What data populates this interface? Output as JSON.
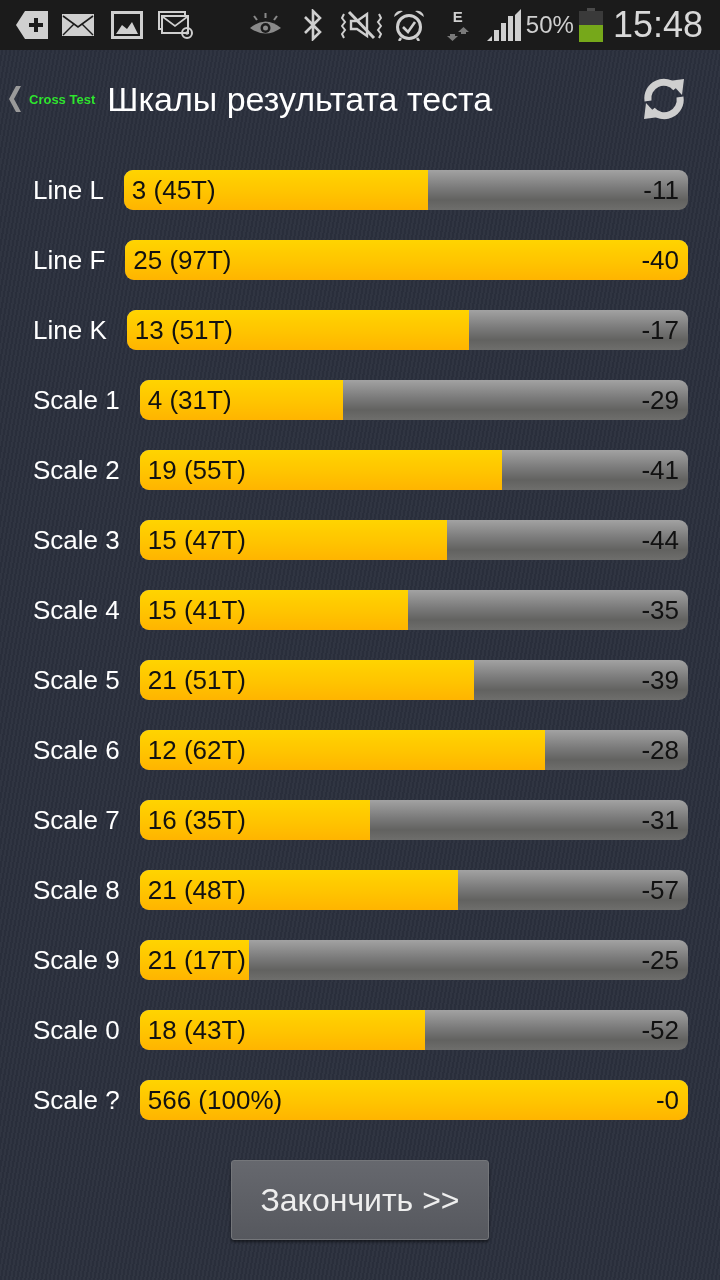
{
  "status_bar": {
    "network_type": "E",
    "battery_text": "50%",
    "time": "15:48"
  },
  "header": {
    "app_name": "Cross Test",
    "title": "Шкалы результата теста"
  },
  "scales": [
    {
      "name": "Line L",
      "score": "3 (45T)",
      "deviation": "-11",
      "level": 0.54
    },
    {
      "name": "Line F",
      "score": "25 (97T)",
      "deviation": "-40",
      "level": 1
    },
    {
      "name": "Line K",
      "score": "13 (51T)",
      "deviation": "-17",
      "level": 0.61
    },
    {
      "name": "Scale 1",
      "score": "4 (31T)",
      "deviation": "-29",
      "level": 0.37
    },
    {
      "name": "Scale 2",
      "score": "19 (55T)",
      "deviation": "-41",
      "level": 0.66
    },
    {
      "name": "Scale 3",
      "score": "15 (47T)",
      "deviation": "-44",
      "level": 0.56
    },
    {
      "name": "Scale 4",
      "score": "15 (41T)",
      "deviation": "-35",
      "level": 0.49
    },
    {
      "name": "Scale 5",
      "score": "21 (51T)",
      "deviation": "-39",
      "level": 0.61
    },
    {
      "name": "Scale 6",
      "score": "12 (62T)",
      "deviation": "-28",
      "level": 0.74
    },
    {
      "name": "Scale 7",
      "score": "16 (35T)",
      "deviation": "-31",
      "level": 0.42
    },
    {
      "name": "Scale 8",
      "score": "21 (48T)",
      "deviation": "-57",
      "level": 0.58
    },
    {
      "name": "Scale 9",
      "score": "21 (17T)",
      "deviation": "-25",
      "level": 0.2
    },
    {
      "name": "Scale 0",
      "score": "18 (43T)",
      "deviation": "-52",
      "level": 0.52
    },
    {
      "name": "Scale ?",
      "score": "566 (100%)",
      "deviation": "-0",
      "level": 1
    }
  ],
  "finish_button": {
    "label": "Закончить >>"
  }
}
